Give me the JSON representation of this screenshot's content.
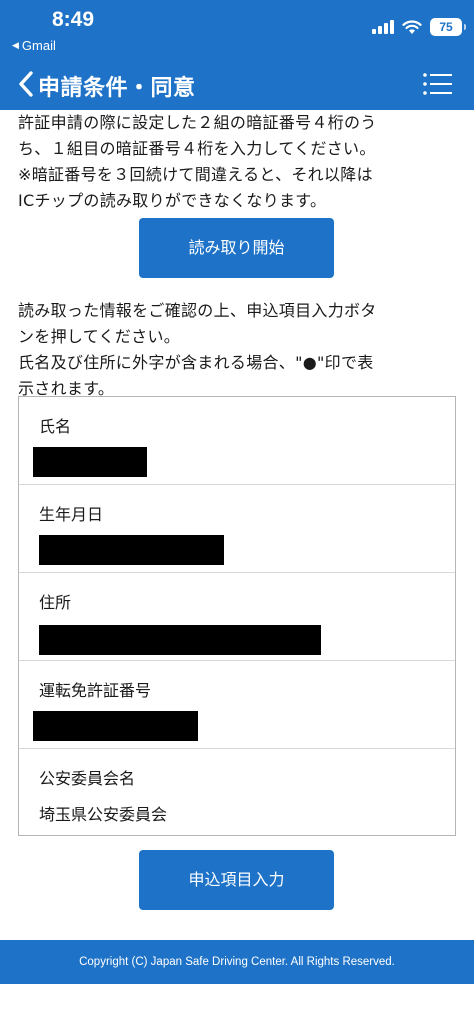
{
  "status_bar": {
    "time": "8:49",
    "back_app": "Gmail",
    "battery": "75"
  },
  "nav": {
    "title": "申請条件・同意",
    "back_icon": "chevron-left-icon",
    "menu_icon": "list-menu-icon"
  },
  "instructions": {
    "line1": "許証申請の際に設定した２組の暗証番号４桁のう",
    "line2": "ち、１組目の暗証番号４桁を入力してください。",
    "line3": "※暗証番号を３回続けて間違えると、それ以降は",
    "line4": "ICチップの読み取りができなくなります。"
  },
  "read_button": {
    "label": "読み取り開始"
  },
  "confirm_text": {
    "line1": "読み取った情報をご確認の上、申込項目入力ボタ",
    "line2": "ンを押してください。",
    "line3": "氏名及び住所に外字が含まれる場合、\"●\"印で表",
    "line4": "示されます。"
  },
  "info": {
    "name_label": "氏名",
    "birth_label": "生年月日",
    "address_label": "住所",
    "license_label": "運転免許証番号",
    "commission_label": "公安委員会名",
    "commission_value": "埼玉県公安委員会"
  },
  "entry_button": {
    "label": "申込項目入力"
  },
  "footer": {
    "copyright": "Copyright (C) Japan Safe Driving Center. All Rights Reserved."
  },
  "colors": {
    "primary": "#1e73c8",
    "redaction": "#000000"
  }
}
